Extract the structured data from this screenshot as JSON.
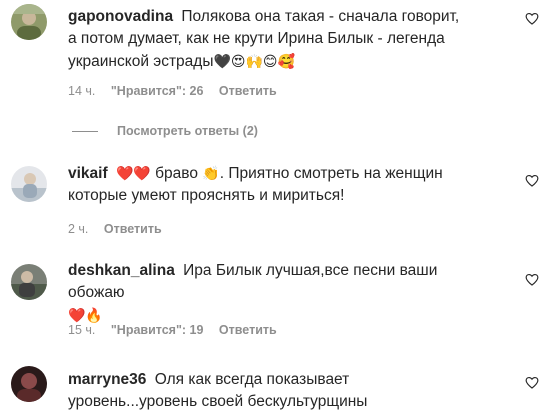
{
  "comments": [
    {
      "username": "gaponovadina",
      "text": "Полякова она такая - сначала говорит, а потом думает, как не крути Ирина Билык - легенда украинской эстрады",
      "emojis": "🖤😍🙌😊🥰",
      "time": "14 ч.",
      "likes": "\"Нравится\": 26",
      "reply": "Ответить"
    },
    {
      "username": "vikaif",
      "text_prefix": "❤️❤️",
      "text": "браво",
      "text_emoji": "👏",
      "text_after": ". Приятно смотреть на женщин которые умеют прояснять и мириться!",
      "time": "2 ч.",
      "reply": "Ответить"
    },
    {
      "username": "deshkan_alina",
      "text": "Ира Билык лучшая,все песни ваши обожаю",
      "emojis": "❤️🔥",
      "time": "15 ч.",
      "likes": "\"Нравится\": 19",
      "reply": "Ответить"
    },
    {
      "username": "marryne36",
      "text": "Оля как всегда показывает уровень...уровень своей бескультурщины"
    }
  ],
  "view_replies": "Посмотреть ответы (2)",
  "icons": {
    "like": "heart-outline-icon"
  }
}
